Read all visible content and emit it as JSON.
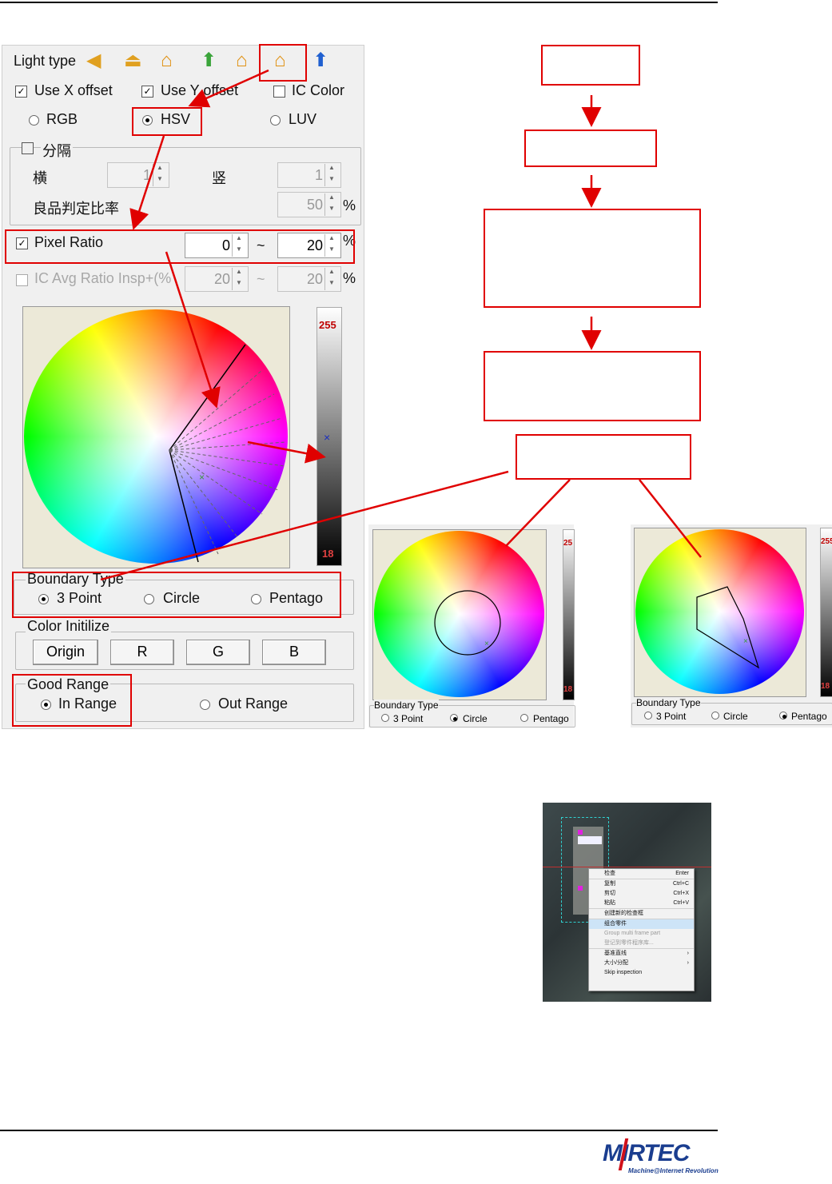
{
  "panel": {
    "light_type_label": "Light type",
    "use_x_offset": "Use X offset",
    "use_y_offset": "Use Y offset",
    "ic_color": "IC Color",
    "rgb": "RGB",
    "hsv": "HSV",
    "luv": "LUV",
    "divide_label": "分隔",
    "horiz_label": "横",
    "vert_label": "竖",
    "horiz_value": "1",
    "vert_value": "1",
    "good_ratio_label": "良品判定比率",
    "good_ratio_value": "50",
    "percent": "%",
    "pixel_ratio_label": "Pixel Ratio",
    "pixel_ratio_min": "0",
    "pixel_ratio_max": "20",
    "tilde": "~",
    "ic_avg_label": "IC Avg Ratio Insp+(%",
    "ic_avg_min": "20",
    "ic_avg_max": "20",
    "bar_top": "255",
    "bar_bottom": "18",
    "bar_marker": "×",
    "boundary_type_label": "Boundary Type",
    "three_point": "3 Point",
    "circle": "Circle",
    "pentagon": "Pentago",
    "color_init_label": "Color Initilize",
    "btn_origin": "Origin",
    "btn_r": "R",
    "btn_g": "G",
    "btn_b": "B",
    "good_range_label": "Good Range",
    "in_range": "In Range",
    "out_range": "Out Range"
  },
  "sample_circle": {
    "boundary_type_label": "Boundary Type",
    "three_point": "3 Point",
    "circle": "Circle",
    "pentagon": "Pentago",
    "bar_top": "25",
    "bar_bottom": "18"
  },
  "sample_pentagon": {
    "boundary_type_label": "Boundary Type",
    "three_point": "3 Point",
    "circle": "Circle",
    "pentagon": "Pentago",
    "bar_top": "255",
    "bar_bottom": "18"
  },
  "context_menu": {
    "items": [
      {
        "label": "检查",
        "shortcut": "Enter"
      },
      {
        "label": "复制",
        "shortcut": "Ctrl+C"
      },
      {
        "label": "剪切",
        "shortcut": "Ctrl+X"
      },
      {
        "label": "粘贴",
        "shortcut": "Ctrl+V"
      },
      {
        "label": "创建新的检查框",
        "shortcut": ""
      },
      {
        "label": "组合零件",
        "shortcut": ""
      },
      {
        "label": "Group multi frame part",
        "shortcut": ""
      },
      {
        "label": "登记到零件程序库...",
        "shortcut": ""
      },
      {
        "label": "基准直线",
        "shortcut": "›"
      },
      {
        "label": "大小/分配",
        "shortcut": "›"
      },
      {
        "label": "Skip inspection",
        "shortcut": ""
      }
    ]
  },
  "logo": {
    "brand": "MIRTEC",
    "tagline": "Machine@Internet Revolution"
  },
  "colors": {
    "annotation_red": "#e00000",
    "logo_blue": "#1a3d8f",
    "logo_red": "#d0101a"
  }
}
